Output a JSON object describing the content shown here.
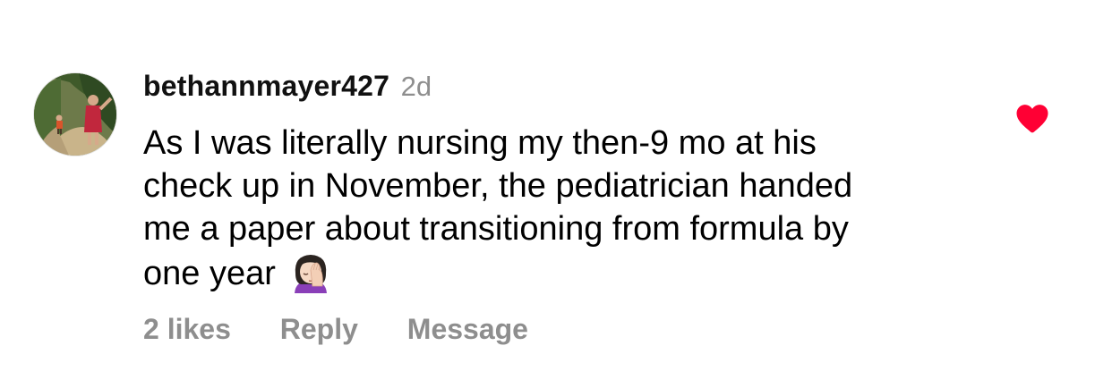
{
  "comment": {
    "username": "bethannmayer427",
    "timestamp": "2d",
    "text_lines": [
      "As I was literally nursing my then-9 mo at his",
      "check up in November, the pediatrician handed",
      "me a paper about transitioning from formula by",
      "one year"
    ],
    "emoji": "woman-facepalming-icon",
    "liked": true,
    "like_color": "#ff0034"
  },
  "actions": {
    "likes": "2 likes",
    "reply": "Reply",
    "message": "Message"
  }
}
